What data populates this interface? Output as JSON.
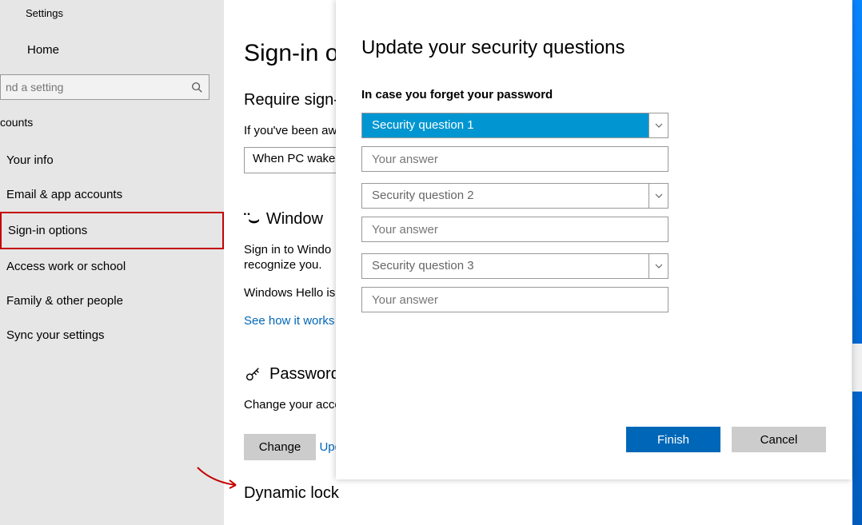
{
  "app_title": "Settings",
  "home_label": "Home",
  "search_placeholder": "nd a setting",
  "section_label": "counts",
  "sidebar": {
    "items": [
      {
        "label": "Your info"
      },
      {
        "label": "Email & app accounts"
      },
      {
        "label": "Sign-in options"
      },
      {
        "label": "Access work or school"
      },
      {
        "label": "Family & other people"
      },
      {
        "label": "Sync your settings"
      }
    ],
    "selected_index": 2
  },
  "main": {
    "title": "Sign-in op",
    "require_header": "Require sign-",
    "require_body": "If you've been aw",
    "require_dropdown": "When PC wakes",
    "hello_header": "Window",
    "hello_body1": "Sign in to Windo",
    "hello_body2": "recognize you.",
    "hello_body3": "Windows Hello is",
    "hello_link": "See how it works",
    "pwd_header": "Password",
    "pwd_body": "Change your acco",
    "change_label": "Change",
    "update_link": "Update your security questions",
    "dynamic_header": "Dynamic lock"
  },
  "modal": {
    "title": "Update your security questions",
    "hint": "In case you forget your password",
    "q1": "Security question 1",
    "q2": "Security question 2",
    "q3": "Security question 3",
    "answer_placeholder": "Your answer",
    "finish": "Finish",
    "cancel": "Cancel"
  }
}
